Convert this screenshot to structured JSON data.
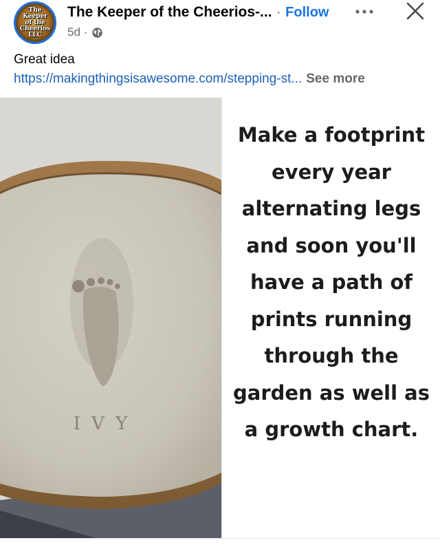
{
  "post": {
    "page_name": "The Keeper of the Cheerios-...",
    "follow_label": "Follow",
    "separator": "·",
    "time": "5d",
    "caption": "Great idea",
    "link": "https://makingthingsisawesome.com/stepping-st...",
    "see_more": "See more",
    "avatar": {
      "line1": "The",
      "line2": "Keeper",
      "line3": "of the",
      "line4": "Cheerios",
      "line5": "LLC"
    }
  },
  "image": {
    "stamp_text": "I V Y",
    "panel_text": "Make a footprint every year alternating legs and soon you'll have a path of prints running through the garden as well as a growth chart."
  },
  "icons": {
    "more": "more-dots-icon",
    "close": "close-icon",
    "privacy": "globe-icon"
  },
  "colors": {
    "follow": "#1b74e4",
    "link": "#1b5fb8",
    "meta": "#65676b"
  }
}
